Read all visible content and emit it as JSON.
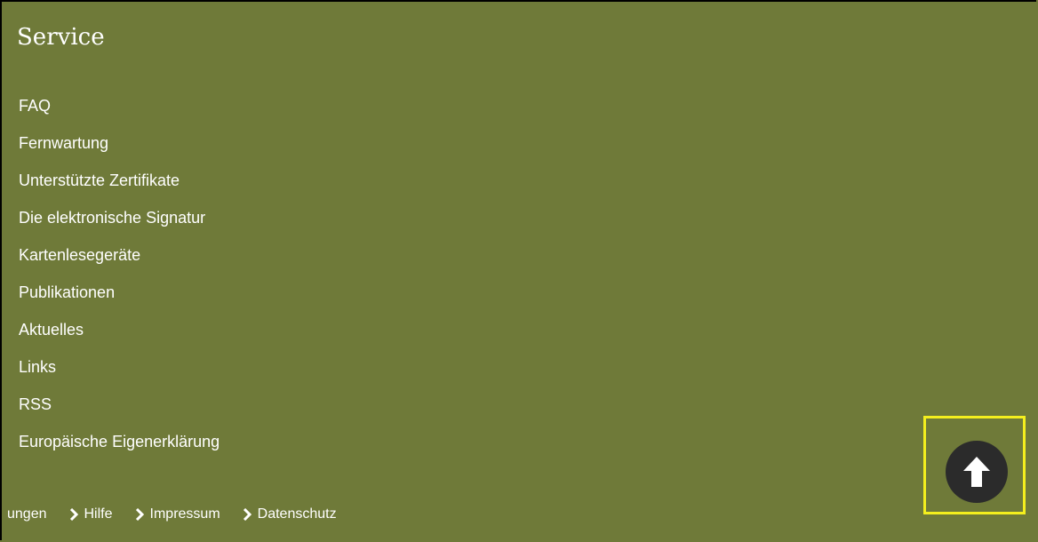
{
  "service": {
    "title": "Service",
    "links": [
      "FAQ",
      "Fernwartung",
      "Unterstützte Zertifikate",
      "Die elektronische Signatur",
      "Kartenlesegeräte",
      "Publikationen",
      "Aktuelles",
      "Links",
      "RSS",
      "Europäische Eigenerklärung"
    ]
  },
  "footer": {
    "partial_label": "ungen",
    "links": [
      "Hilfe",
      "Impressum",
      "Datenschutz"
    ]
  },
  "back_to_top": {
    "icon": "arrow-up-icon"
  },
  "colors": {
    "background": "#6f7a39",
    "text": "#ffffff",
    "button": "#2b2b2b",
    "highlight": "#f4ef1e"
  }
}
